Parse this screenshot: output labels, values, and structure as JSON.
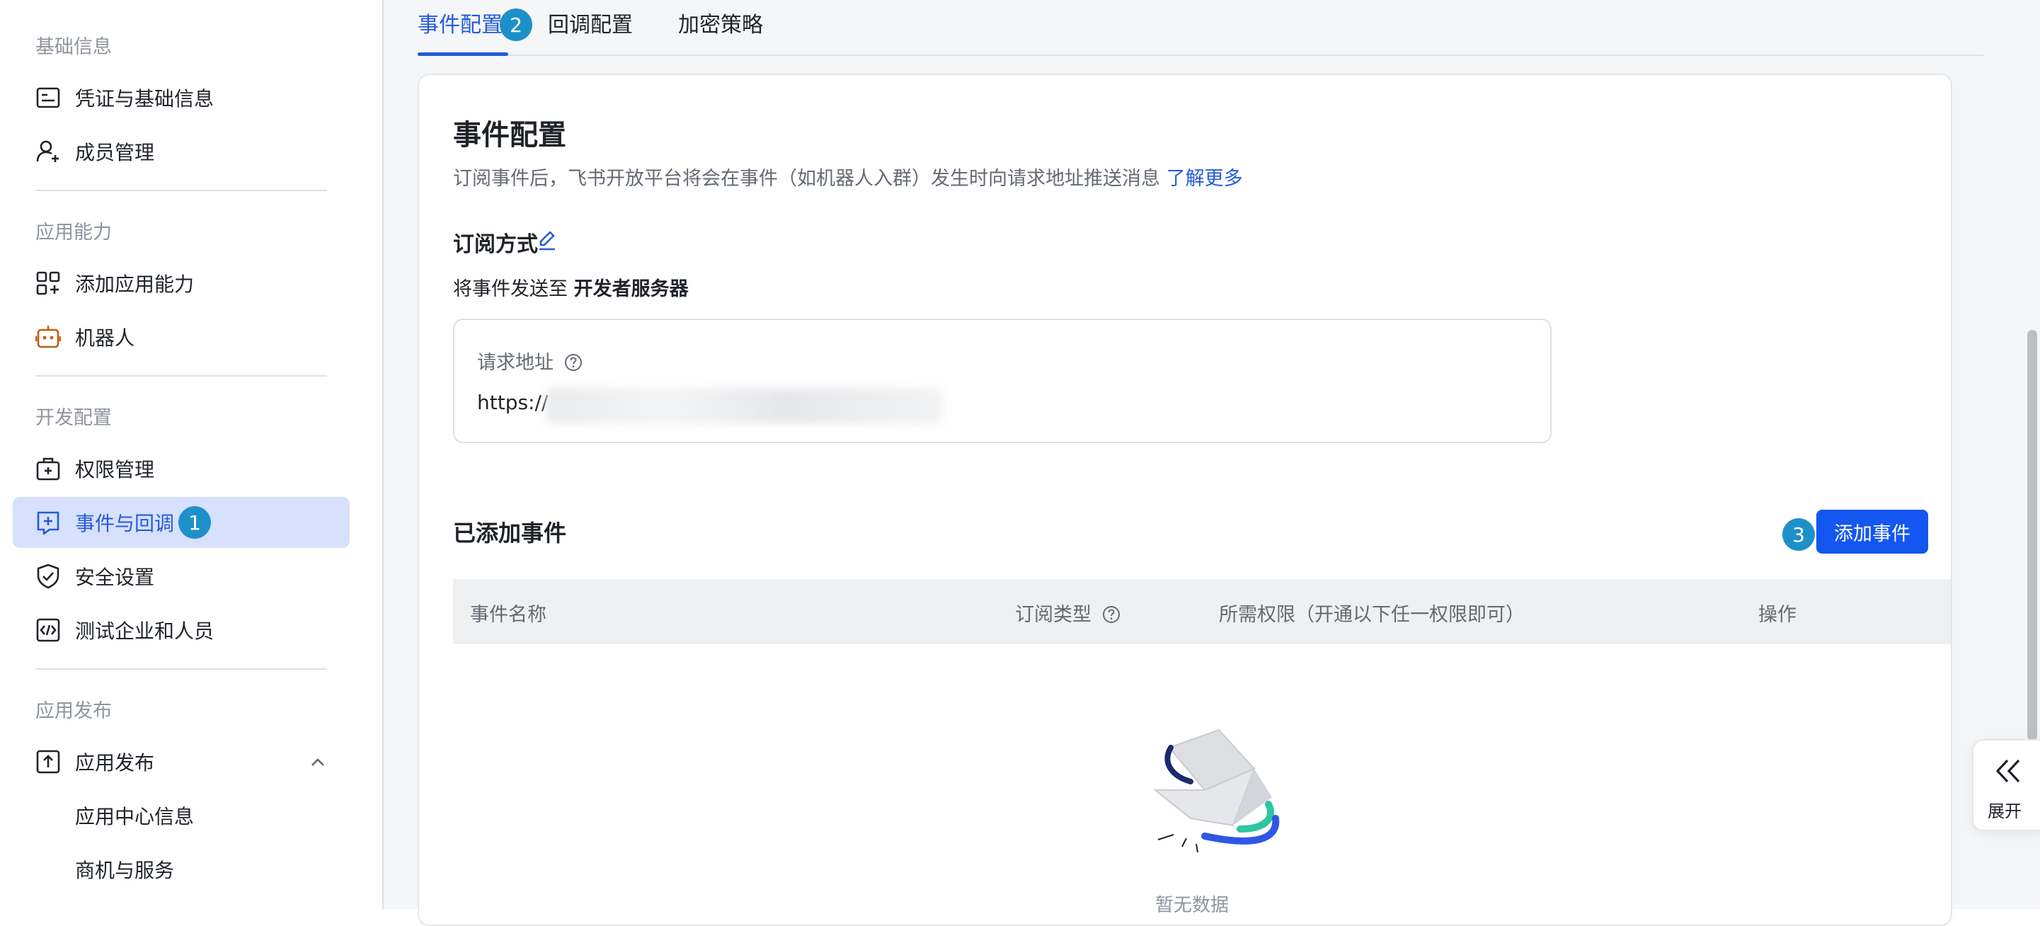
{
  "sidebar": {
    "groups": [
      {
        "title": "基础信息"
      },
      {
        "title": "应用能力"
      },
      {
        "title": "开发配置"
      },
      {
        "title": "应用发布"
      }
    ],
    "items": [
      {
        "label": "凭证与基础信息"
      },
      {
        "label": "成员管理"
      },
      {
        "label": "添加应用能力"
      },
      {
        "label": "机器人"
      },
      {
        "label": "权限管理"
      },
      {
        "label": "事件与回调"
      },
      {
        "label": "安全设置"
      },
      {
        "label": "测试企业和人员"
      },
      {
        "label": "应用发布"
      },
      {
        "label": "应用中心信息"
      },
      {
        "label": "商机与服务"
      }
    ],
    "active_item": "事件与回调"
  },
  "tabs": [
    {
      "label": "事件配置"
    },
    {
      "label": "回调配置"
    },
    {
      "label": "加密策略"
    }
  ],
  "badges": [
    "1",
    "2",
    "3"
  ],
  "event_config": {
    "title": "事件配置",
    "description": "订阅事件后，飞书开放平台将会在事件（如机器人入群）发生时向请求地址推送消息",
    "learn_more": "了解更多",
    "subscribe_title": "订阅方式",
    "send_prefix": "将事件发送至",
    "send_target": "开发者服务器",
    "url_label": "请求地址",
    "url_value": "https://",
    "added_title": "已添加事件",
    "add_button": "添加事件",
    "columns": [
      "事件名称",
      "订阅类型",
      "所需权限（开通以下任一权限即可）",
      "操作"
    ],
    "empty_text": "暂无数据"
  },
  "expand": {
    "label": "展开"
  },
  "colors": {
    "accent": "#245bdb",
    "button": "#1456f0",
    "badge": "#1e90c9",
    "active_bg": "#d7e0fc"
  }
}
